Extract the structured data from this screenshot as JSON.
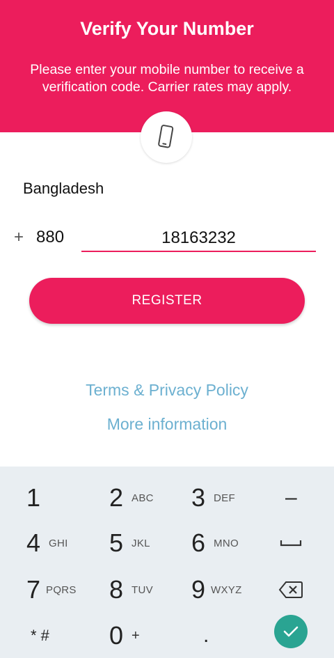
{
  "header": {
    "title": "Verify Your Number",
    "subtitle": "Please enter your mobile number to receive a verification code. Carrier rates may apply."
  },
  "form": {
    "country": "Bangladesh",
    "plus": "+",
    "country_code": "880",
    "phone_number": "18163232",
    "register_label": "REGISTER"
  },
  "links": {
    "terms": "Terms & Privacy Policy",
    "more": "More information"
  },
  "keypad": {
    "k1": "1",
    "k2": "2",
    "k2_letters": "ABC",
    "k3": "3",
    "k3_letters": "DEF",
    "dash": "–",
    "k4": "4",
    "k4_letters": "GHI",
    "k5": "5",
    "k5_letters": "JKL",
    "k6": "6",
    "k6_letters": "MNO",
    "k7": "7",
    "k7_letters": "PQRS",
    "k8": "8",
    "k8_letters": "TUV",
    "k9": "9",
    "k9_letters": "WXYZ",
    "star_hash": "* #",
    "k0": "0",
    "k0_letters": "+",
    "dot": "."
  },
  "colors": {
    "accent": "#ec1d5c",
    "link": "#6cb0d0",
    "keypad_bg": "#e9eef2",
    "confirm": "#2aa492"
  },
  "icons": {
    "phone": "smartphone-icon",
    "space": "space-bar-icon",
    "backspace": "backspace-icon",
    "confirm": "check-icon"
  }
}
